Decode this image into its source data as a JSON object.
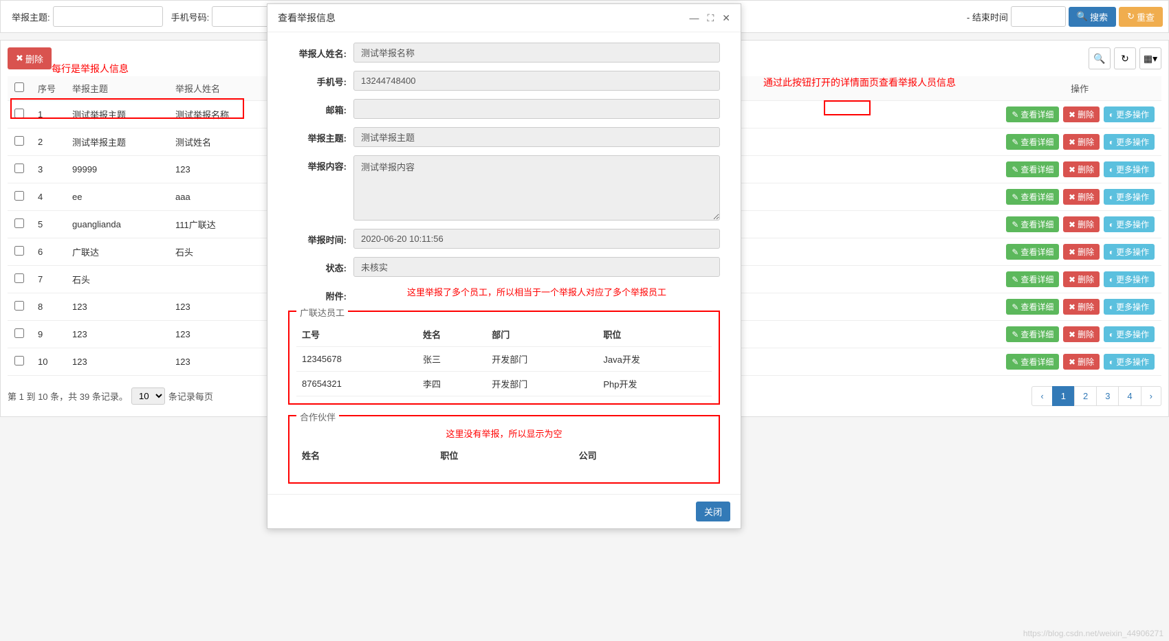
{
  "filterBar": {
    "topicLabel": "举报主题:",
    "phoneLabel": "手机号码:",
    "endTimeLabel": "- 结束时间",
    "timeInputPartial": "间",
    "searchBtn": "搜索",
    "resetBtn": "重查"
  },
  "toolbar": {
    "deleteBtn": "删除"
  },
  "annotations": {
    "rowInfo": "每行是举报人信息",
    "detailInfo": "通过此按钮打开的详情面页查看举报人员信息",
    "multiEmployee": "这里举报了多个员工，所以相当于一个举报人对应了多个举报员工",
    "emptyPartner": "这里没有举报，所以显示为空"
  },
  "table": {
    "headers": {
      "seq": "序号",
      "topic": "举报主题",
      "name": "举报人姓名",
      "actions": "操作"
    },
    "actionLabels": {
      "view": "查看详细",
      "delete": "删除",
      "more": "更多操作"
    },
    "rows": [
      {
        "seq": "1",
        "topic": "测试举报主题",
        "name": "测试举报名称"
      },
      {
        "seq": "2",
        "topic": "测试举报主题",
        "name": "测试姓名"
      },
      {
        "seq": "3",
        "topic": "99999",
        "name": "123"
      },
      {
        "seq": "4",
        "topic": "ee",
        "name": "aaa"
      },
      {
        "seq": "5",
        "topic": "guanglianda",
        "name": "111广联达"
      },
      {
        "seq": "6",
        "topic": "广联达",
        "name": "石头"
      },
      {
        "seq": "7",
        "topic": "石头",
        "name": ""
      },
      {
        "seq": "8",
        "topic": "123",
        "name": "123"
      },
      {
        "seq": "9",
        "topic": "123",
        "name": "123"
      },
      {
        "seq": "10",
        "topic": "123",
        "name": "123"
      }
    ]
  },
  "pagination": {
    "info": "第 1 到 10 条，共 39 条记录。",
    "perPage": "10",
    "perPageSuffix": "条记录每页",
    "pages": [
      "1",
      "2",
      "3",
      "4"
    ],
    "prev": "‹",
    "next": "›"
  },
  "modal": {
    "title": "查看举报信息",
    "labels": {
      "name": "举报人姓名:",
      "phone": "手机号:",
      "email": "邮箱:",
      "topic": "举报主题:",
      "content": "举报内容:",
      "time": "举报时间:",
      "status": "状态:",
      "attachment": "附件:"
    },
    "values": {
      "name": "测试举报名称",
      "phone": "13244748400",
      "email": "",
      "topic": "测试举报主题",
      "content": "测试举报内容",
      "time": "2020-06-20 10:11:56",
      "status": "未核实"
    },
    "employeeSection": {
      "legend": "广联达员工",
      "headers": {
        "id": "工号",
        "name": "姓名",
        "dept": "部门",
        "position": "职位"
      },
      "rows": [
        {
          "id": "12345678",
          "name": "张三",
          "dept": "开发部门",
          "position": "Java开发"
        },
        {
          "id": "87654321",
          "name": "李四",
          "dept": "开发部门",
          "position": "Php开发"
        }
      ]
    },
    "partnerSection": {
      "legend": "合作伙伴",
      "headers": {
        "name": "姓名",
        "position": "职位",
        "company": "公司"
      }
    },
    "closeBtn": "关闭"
  },
  "watermark": "https://blog.csdn.net/weixin_44906271"
}
